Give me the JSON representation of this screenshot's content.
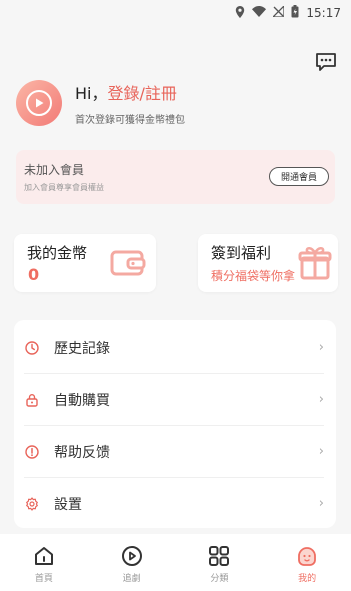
{
  "status_bar": {
    "time": "15:17"
  },
  "header": {
    "message_icon": "chat-bubble-icon"
  },
  "profile": {
    "greeting": "Hi，",
    "login_link": "登錄/註冊",
    "subtitle": "首次登錄可獲得金幣禮包"
  },
  "vip": {
    "title": "未加入會員",
    "description": "加入會員尊享會員權益",
    "button_label": "開通會員"
  },
  "cards": {
    "coins": {
      "title": "我的金幣",
      "value": "0"
    },
    "checkin": {
      "title": "簽到福利",
      "subtitle": "積分福袋等你拿"
    }
  },
  "menu": {
    "items": [
      {
        "label": "歷史記錄",
        "icon": "clock-icon"
      },
      {
        "label": "自動購買",
        "icon": "lock-icon"
      },
      {
        "label": "帮助反馈",
        "icon": "alert-icon"
      },
      {
        "label": "設置",
        "icon": "gear-icon"
      }
    ],
    "arrow": "›"
  },
  "tabbar": {
    "tabs": [
      {
        "label": "首頁",
        "icon": "home-icon",
        "active": false
      },
      {
        "label": "追劇",
        "icon": "play-icon",
        "active": false
      },
      {
        "label": "分類",
        "icon": "grid-icon",
        "active": false
      },
      {
        "label": "我的",
        "icon": "profile-face-icon",
        "active": true
      }
    ]
  },
  "colors": {
    "accent": "#ef6e62",
    "vip_bg": "#fbecec",
    "background": "#f6f6f6"
  }
}
